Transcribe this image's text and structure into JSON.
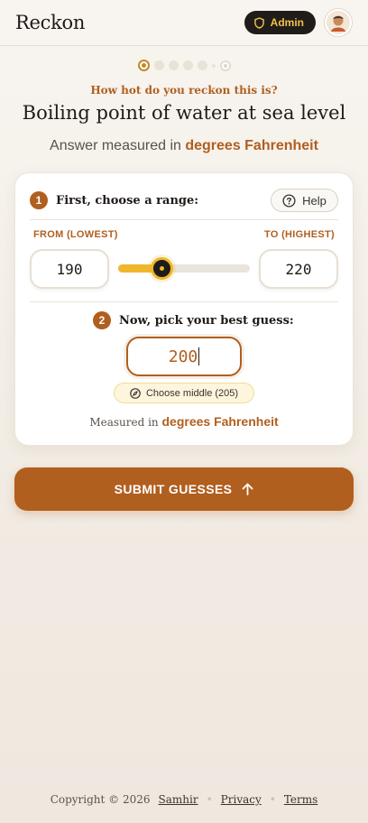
{
  "header": {
    "logo": "Reckon",
    "admin_label": "Admin"
  },
  "progress": {
    "current_step": 1,
    "total_steps": 6
  },
  "question": {
    "kicker": "How hot do you reckon this is?",
    "title": "Boiling point of water at sea level",
    "unit_prefix": "Answer measured in",
    "unit": "degrees Fahrenheit"
  },
  "range": {
    "step_number": "1",
    "step_label": "First, choose a range:",
    "help_label": "Help",
    "from_label": "FROM (LOWEST)",
    "to_label": "TO (HIGHEST)",
    "from_value": "190",
    "to_value": "220",
    "slider_fill_fraction": 0.33
  },
  "guess": {
    "step_number": "2",
    "step_label": "Now, pick your best guess:",
    "value": "200",
    "middle_label": "Choose middle (205)",
    "measured_prefix": "Measured in",
    "measured_unit": "degrees Fahrenheit"
  },
  "submit_label": "SUBMIT GUESSES",
  "footer": {
    "copyright": "Copyright © 2026",
    "author": "Samhir",
    "privacy": "Privacy",
    "terms": "Terms"
  },
  "colors": {
    "accent": "#b05f1f",
    "gold": "#f0b62c",
    "dark": "#1f1c19"
  }
}
